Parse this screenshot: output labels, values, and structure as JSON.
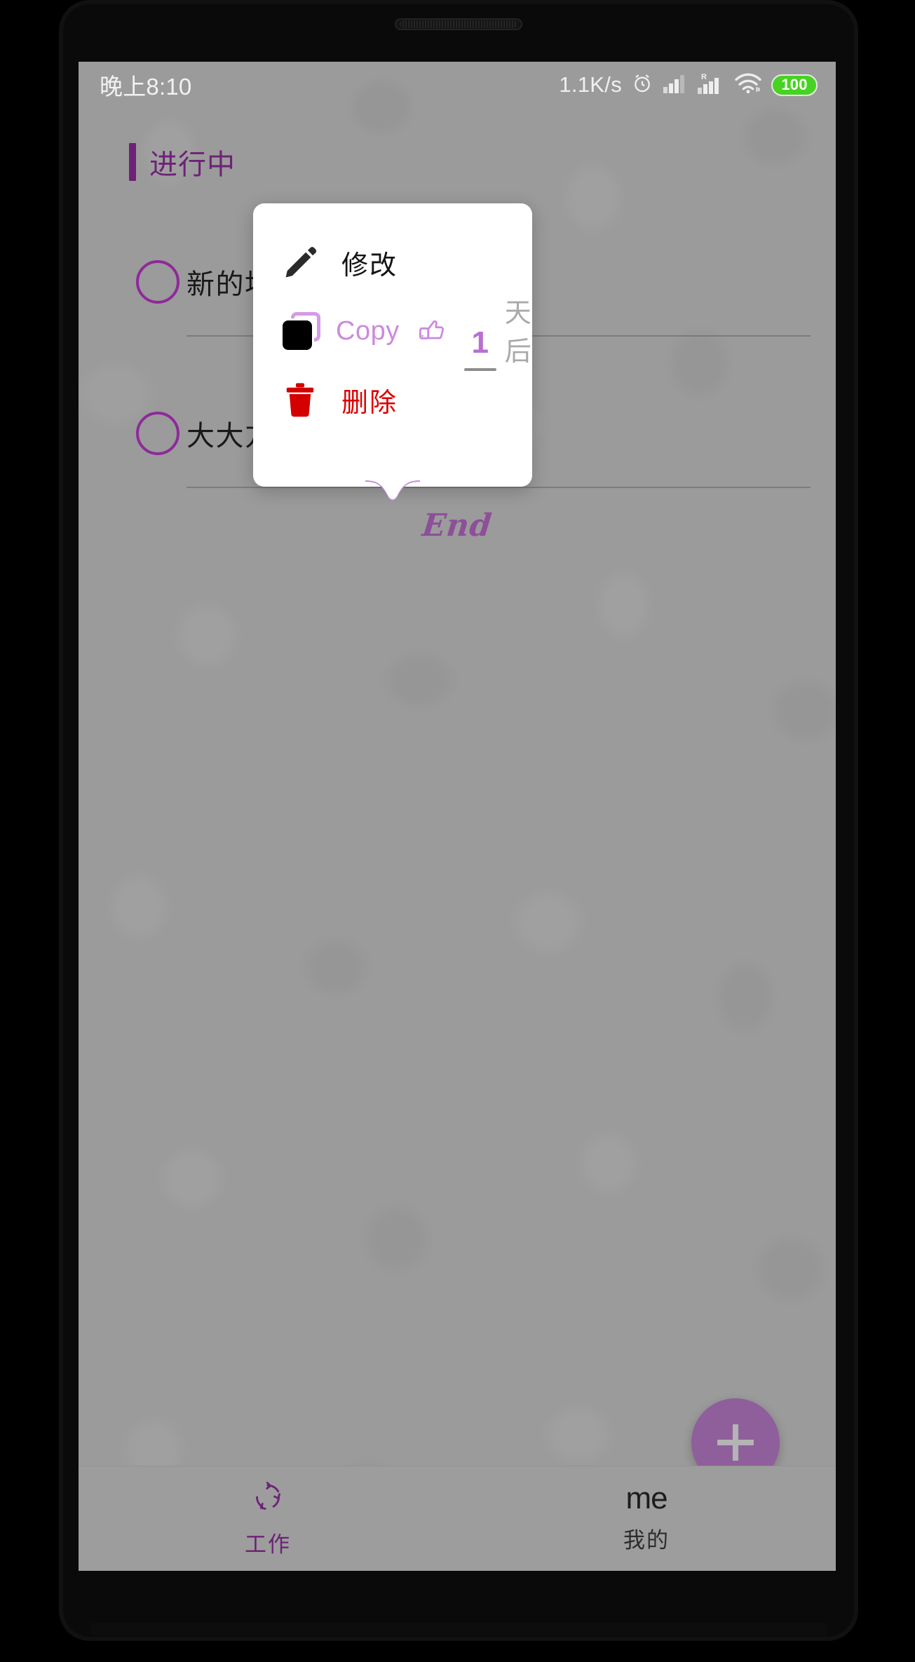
{
  "statusbar": {
    "time": "晚上8:10",
    "net_speed": "1.1K/s",
    "alarm_icon": "alarm-clock-icon",
    "signal_icon": "signal-bars-icon",
    "roaming_label": "R",
    "roaming_signal_icon": "roaming-signal-bars-icon",
    "wifi_icon": "wifi-icon",
    "battery_level": "100",
    "battery_color": "#46d321"
  },
  "content": {
    "section_title": "进行中",
    "accent_color": "#6d2277",
    "tasks": [
      {
        "label": "新的地",
        "checkbox": "unchecked-circle"
      },
      {
        "label": "大大方方的",
        "checkbox": "unchecked-circle"
      }
    ],
    "end_marker": "End"
  },
  "fab": {
    "icon": "plus-icon",
    "color": "#8f5f9c"
  },
  "popup": {
    "items": [
      {
        "id": "edit",
        "icon": "pencil-icon",
        "label": "修改",
        "color": "#141414"
      },
      {
        "id": "copy",
        "icon": "copy-icon",
        "label": "Copy",
        "color": "#cc8add"
      },
      {
        "id": "delete",
        "icon": "trash-icon",
        "label": "删除",
        "color": "#dd0000"
      }
    ],
    "thumb_icon": "thumbs-up-icon",
    "day_value": "1",
    "day_unit": "天后"
  },
  "bottomnav": {
    "tabs": [
      {
        "id": "work",
        "icon": "cycle-refresh-icon",
        "label": "工作",
        "active": true
      },
      {
        "id": "mine",
        "icon": "me-icon",
        "icon_text": "me",
        "label": "我的",
        "active": false
      }
    ]
  }
}
